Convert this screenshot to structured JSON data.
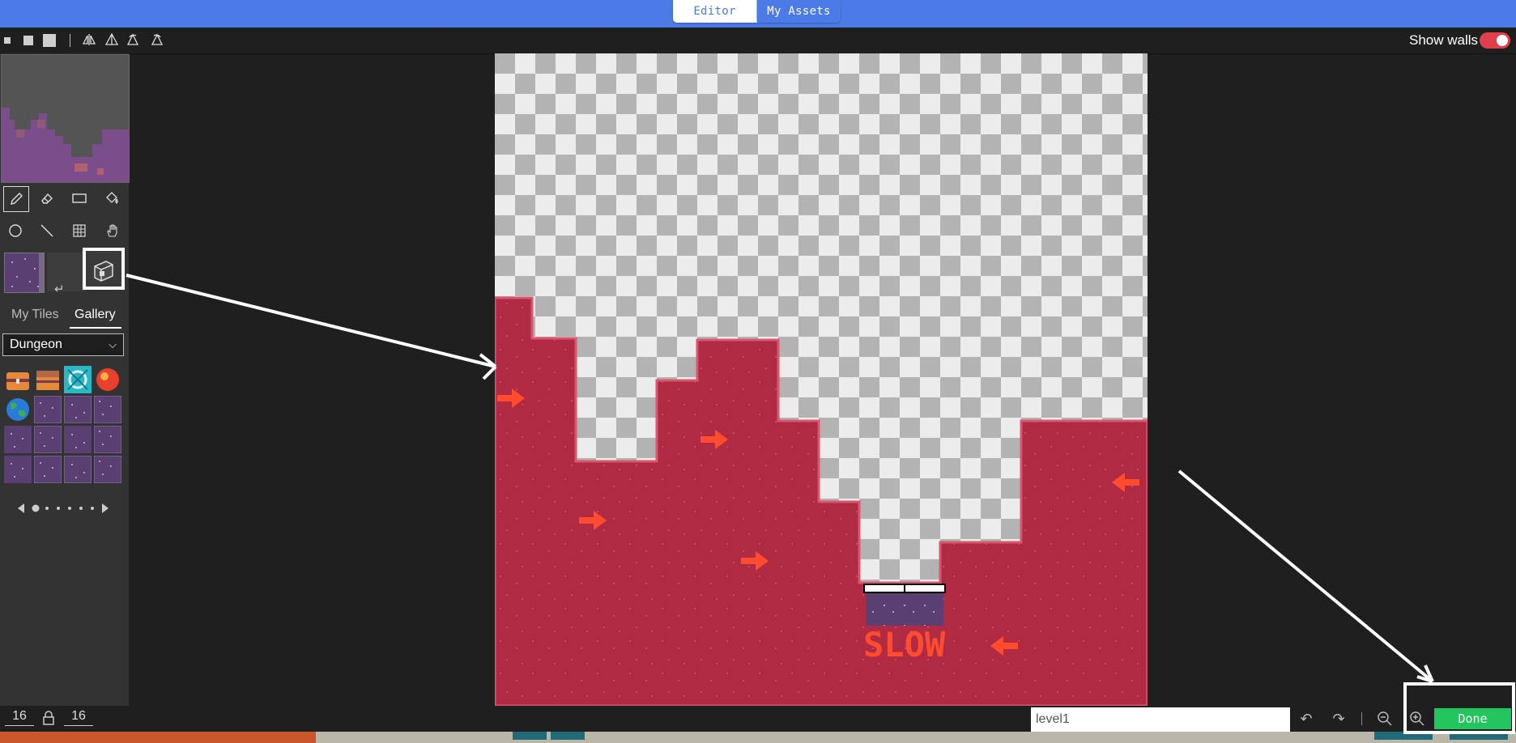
{
  "topbar": {
    "tabs": [
      {
        "label": "Editor",
        "active": true
      },
      {
        "label": "My Assets",
        "active": false
      }
    ]
  },
  "toolbar": {
    "brush_sizes": [
      "small-square",
      "medium-square",
      "large-square"
    ],
    "transform_icons": [
      "flip-horizontal-icon",
      "flip-vertical-icon",
      "rotate-left-icon",
      "rotate-right-icon"
    ],
    "show_walls_label": "Show walls",
    "show_walls_on": true
  },
  "tools": {
    "row1": [
      "pencil-icon",
      "eraser-icon",
      "rectangle-icon",
      "fill-bucket-icon"
    ],
    "row2": [
      "circle-icon",
      "line-icon",
      "grid-select-icon",
      "hand-icon"
    ],
    "selected": "pencil-icon"
  },
  "gallery": {
    "tabs": [
      "My Tiles",
      "Gallery"
    ],
    "active_tab": "Gallery",
    "category": "Dungeon",
    "tiles": [
      "treasure-chest-closed",
      "treasure-chest-open",
      "portal-tile",
      "red-orb",
      "earth-globe",
      "dungeon-floor",
      "dungeon-floor",
      "dungeon-floor",
      "dungeon-floor",
      "dungeon-floor",
      "dungeon-floor",
      "dungeon-floor",
      "dungeon-floor",
      "dungeon-floor",
      "dungeon-floor",
      "dungeon-floor"
    ],
    "page": 1,
    "page_count": 6
  },
  "canvas": {
    "label_text": "SLOW"
  },
  "bottombar": {
    "width": "16",
    "height": "16",
    "level_name": "level1",
    "done_label": "Done"
  },
  "colors": {
    "accent": "#4b7be6",
    "done": "#22c55e",
    "ground": "#b02a44",
    "arrow": "#ff4b2e",
    "toggle": "#e0404a"
  }
}
